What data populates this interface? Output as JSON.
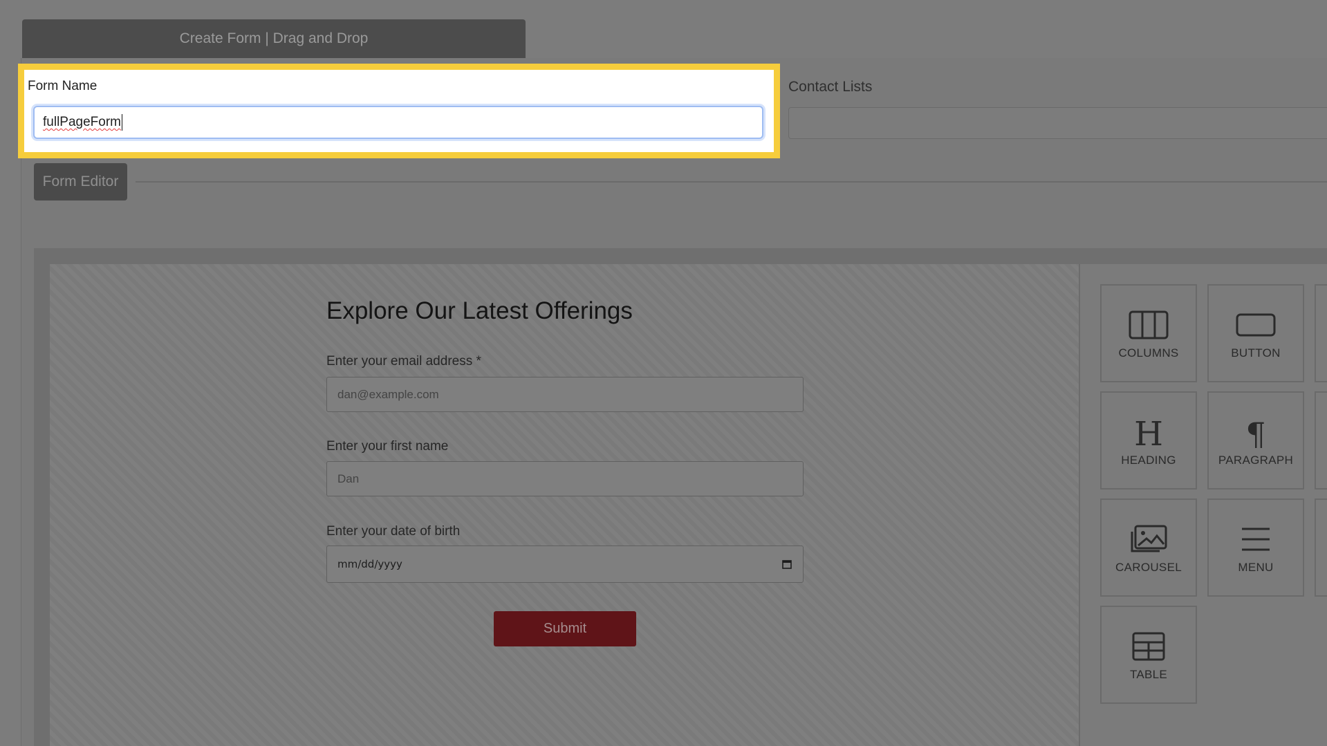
{
  "header": {
    "title": "Create Form | Drag and Drop"
  },
  "form_name": {
    "label": "Form Name",
    "value": "fullPageForm"
  },
  "contact_lists": {
    "label": "Contact Lists",
    "value": ""
  },
  "editor_tab": {
    "label": "Form Editor"
  },
  "preview": {
    "title": "Explore Our Latest Offerings",
    "fields": [
      {
        "label": "Enter your email address *",
        "placeholder": "dan@example.com"
      },
      {
        "label": "Enter your first name",
        "placeholder": "Dan"
      },
      {
        "label": "Enter your date of birth",
        "placeholder": "mm/dd/yyyy"
      }
    ],
    "submit_label": "Submit"
  },
  "tools": [
    {
      "label": "COLUMNS",
      "icon": "columns-icon"
    },
    {
      "label": "BUTTON",
      "icon": "button-icon"
    },
    {
      "label": "HEADING",
      "icon": "heading-icon"
    },
    {
      "label": "PARAGRAPH",
      "icon": "paragraph-icon"
    },
    {
      "label": "CAROUSEL",
      "icon": "carousel-icon"
    },
    {
      "label": "MENU",
      "icon": "menu-icon"
    },
    {
      "label": "TABLE",
      "icon": "table-icon"
    }
  ],
  "colors": {
    "highlight": "#f6cd3c",
    "submit": "#5f1418",
    "overlay": "#7c7c7c"
  }
}
